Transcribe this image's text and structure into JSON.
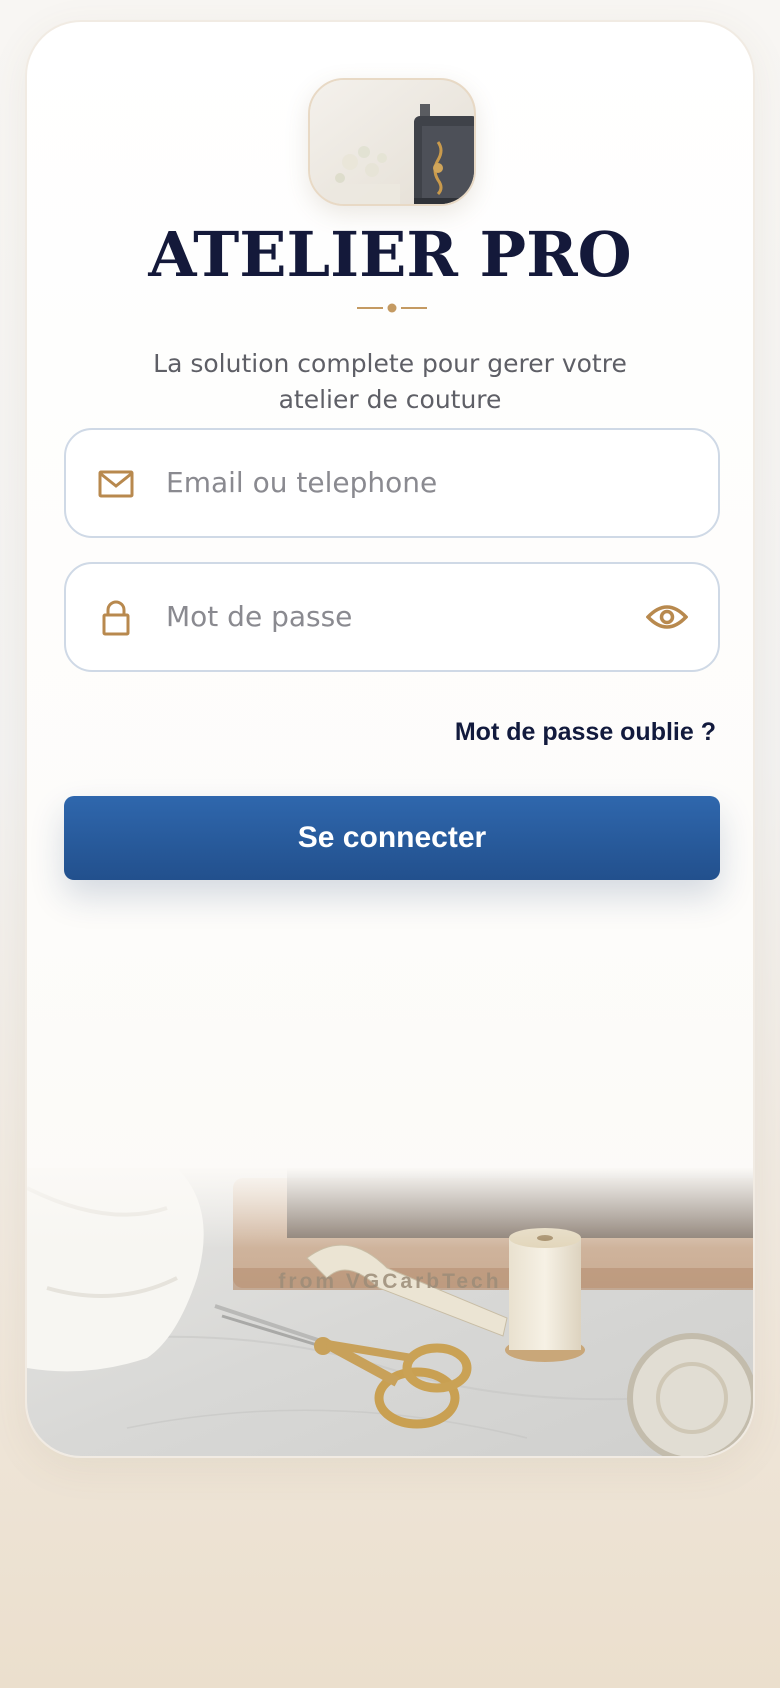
{
  "app": {
    "title": "ATELIER PRO",
    "subtitle": "La solution complete pour gerer votre atelier de couture",
    "footer": "from VGCarbTech"
  },
  "form": {
    "email_placeholder": "Email ou telephone",
    "password_placeholder": "Mot de passe",
    "forgot_label": "Mot de passe oublie ?",
    "login_label": "Se connecter"
  },
  "icons": {
    "email": "envelope-icon",
    "password": "lock-icon",
    "toggle": "eye-icon"
  },
  "colors": {
    "accent_gold": "#b8894e",
    "title_navy": "#14193a",
    "button_blue": "#2a5c9e",
    "field_border": "#cfd9e6"
  }
}
